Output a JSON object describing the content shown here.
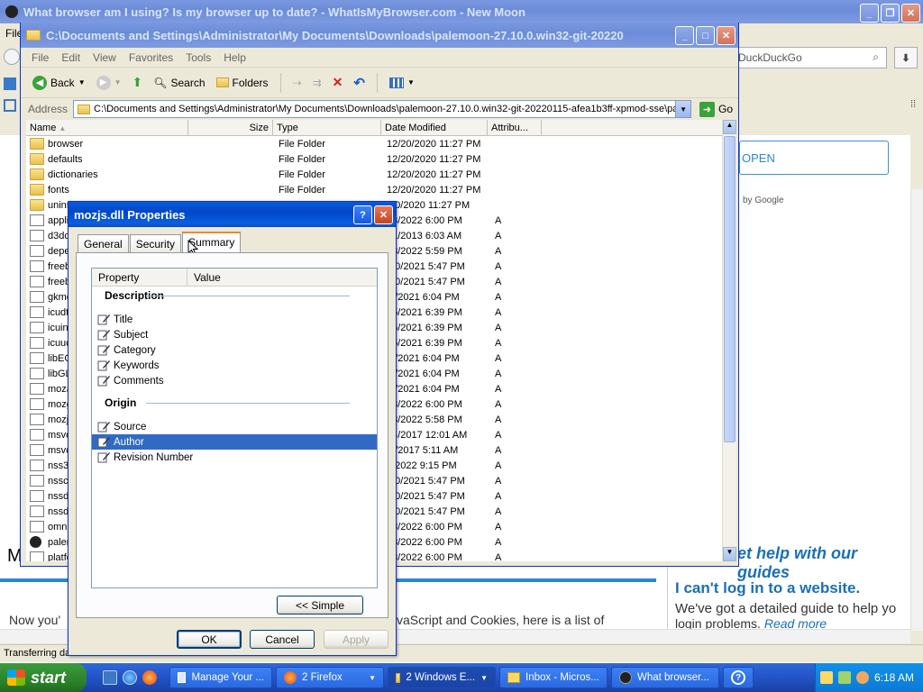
{
  "browser": {
    "title": "What browser am I using? Is my browser up to date? - WhatIsMyBrowser.com - New Moon",
    "menu_first": "File",
    "search_placeholder": "DuckDuckGo",
    "open_button": "OPEN",
    "by_google": "by Google",
    "page_left_fragment": "M",
    "help_heading": "et help with our guides",
    "cant_login_heading": "I can't log in to a website.",
    "cant_login_text": "We've got a detailed guide to help yo",
    "cant_login_text2": "login problems.",
    "read_more": "Read more",
    "now_you": "Now you'",
    "js_cookies": "vaScript and Cookies, here is a list of",
    "status": "Transferring da"
  },
  "explorer": {
    "title": "C:\\Documents and Settings\\Administrator\\My Documents\\Downloads\\palemoon-27.10.0.win32-git-20220",
    "menu": [
      "File",
      "Edit",
      "View",
      "Favorites",
      "Tools",
      "Help"
    ],
    "toolbar": {
      "back": "Back",
      "search": "Search",
      "folders": "Folders"
    },
    "address_label": "Address",
    "address_value": "C:\\Documents and Settings\\Administrator\\My Documents\\Downloads\\palemoon-27.10.0.win32-git-20220115-afea1b3ff-xpmod-sse\\pa",
    "go_label": "Go",
    "columns": {
      "name": "Name",
      "size": "Size",
      "type": "Type",
      "date": "Date Modified",
      "attr": "Attribu..."
    },
    "rows": [
      {
        "name": "browser",
        "type": "File Folder",
        "date": "12/20/2020 11:27 PM",
        "attr": "",
        "icon": "folder"
      },
      {
        "name": "defaults",
        "type": "File Folder",
        "date": "12/20/2020 11:27 PM",
        "attr": "",
        "icon": "folder"
      },
      {
        "name": "dictionaries",
        "type": "File Folder",
        "date": "12/20/2020 11:27 PM",
        "attr": "",
        "icon": "folder"
      },
      {
        "name": "fonts",
        "type": "File Folder",
        "date": "12/20/2020 11:27 PM",
        "attr": "",
        "icon": "folder"
      },
      {
        "name": "unins",
        "type": "",
        "date": "/20/2020 11:27 PM",
        "attr": "",
        "icon": "folder"
      },
      {
        "name": "applic",
        "type": "",
        "date": "13/2022 6:00 PM",
        "attr": "A",
        "icon": "file"
      },
      {
        "name": "d3dc",
        "type": "",
        "date": "21/2013 6:03 AM",
        "attr": "A",
        "icon": "file"
      },
      {
        "name": "depe",
        "type": "",
        "date": "13/2022 5:59 PM",
        "attr": "A",
        "icon": "file"
      },
      {
        "name": "freeb",
        "type": "",
        "date": "/30/2021 5:47 PM",
        "attr": "A",
        "icon": "file"
      },
      {
        "name": "freeb",
        "type": "",
        "date": "/30/2021 5:47 PM",
        "attr": "A",
        "icon": "file"
      },
      {
        "name": "gkme",
        "type": "",
        "date": "/2/2021 6:04 PM",
        "attr": "A",
        "icon": "file"
      },
      {
        "name": "icudt",
        "type": "",
        "date": "25/2021 6:39 PM",
        "attr": "A",
        "icon": "file"
      },
      {
        "name": "icuin",
        "type": "",
        "date": "25/2021 6:39 PM",
        "attr": "A",
        "icon": "file"
      },
      {
        "name": "icuuc",
        "type": "",
        "date": "25/2021 6:39 PM",
        "attr": "A",
        "icon": "file"
      },
      {
        "name": "libEG",
        "type": "",
        "date": "/2/2021 6:04 PM",
        "attr": "A",
        "icon": "file"
      },
      {
        "name": "libGL",
        "type": "",
        "date": "/2/2021 6:04 PM",
        "attr": "A",
        "icon": "file"
      },
      {
        "name": "moza",
        "type": "",
        "date": "/2/2021 6:04 PM",
        "attr": "A",
        "icon": "file"
      },
      {
        "name": "mozg",
        "type": "",
        "date": "13/2022 6:00 PM",
        "attr": "A",
        "icon": "file"
      },
      {
        "name": "mozjs",
        "type": "",
        "date": "13/2022 5:58 PM",
        "attr": "A",
        "icon": "file"
      },
      {
        "name": "msvc",
        "type": "",
        "date": "24/2017 12:01 AM",
        "attr": "A",
        "icon": "file"
      },
      {
        "name": "msvc",
        "type": "",
        "date": "/7/2017 5:11 AM",
        "attr": "A",
        "icon": "file"
      },
      {
        "name": "nss3",
        "type": "",
        "date": "6/2022 9:15 PM",
        "attr": "A",
        "icon": "file"
      },
      {
        "name": "nssck",
        "type": "",
        "date": "/30/2021 5:47 PM",
        "attr": "A",
        "icon": "file"
      },
      {
        "name": "nssdb",
        "type": "",
        "date": "/30/2021 5:47 PM",
        "attr": "A",
        "icon": "file"
      },
      {
        "name": "nssdb",
        "type": "",
        "date": "/30/2021 5:47 PM",
        "attr": "A",
        "icon": "file"
      },
      {
        "name": "omni.",
        "type": "",
        "date": "13/2022 6:00 PM",
        "attr": "A",
        "icon": "file"
      },
      {
        "name": "paler",
        "type": "",
        "date": "13/2022 6:00 PM",
        "attr": "A",
        "icon": "moon"
      },
      {
        "name": "platfo",
        "type": "",
        "date": "13/2022 6:00 PM",
        "attr": "A",
        "icon": "file"
      }
    ]
  },
  "dialog": {
    "title": "mozjs.dll Properties",
    "tabs": [
      "General",
      "Security",
      "Summary"
    ],
    "columns": {
      "property": "Property",
      "value": "Value"
    },
    "sections": [
      {
        "heading": "Description",
        "items": [
          "Title",
          "Subject",
          "Category",
          "Keywords",
          "Comments"
        ]
      },
      {
        "heading": "Origin",
        "items": [
          "Source",
          "Author",
          "Revision Number"
        ]
      }
    ],
    "selected_item": "Author",
    "simple_button": "<< Simple",
    "ok": "OK",
    "cancel": "Cancel",
    "apply": "Apply"
  },
  "taskbar": {
    "start": "start",
    "tasks": [
      "Manage Your ...",
      "2 Firefox",
      "2 Windows E...",
      "Inbox - Micros...",
      "What browser..."
    ],
    "clock": "6:18 AM"
  }
}
